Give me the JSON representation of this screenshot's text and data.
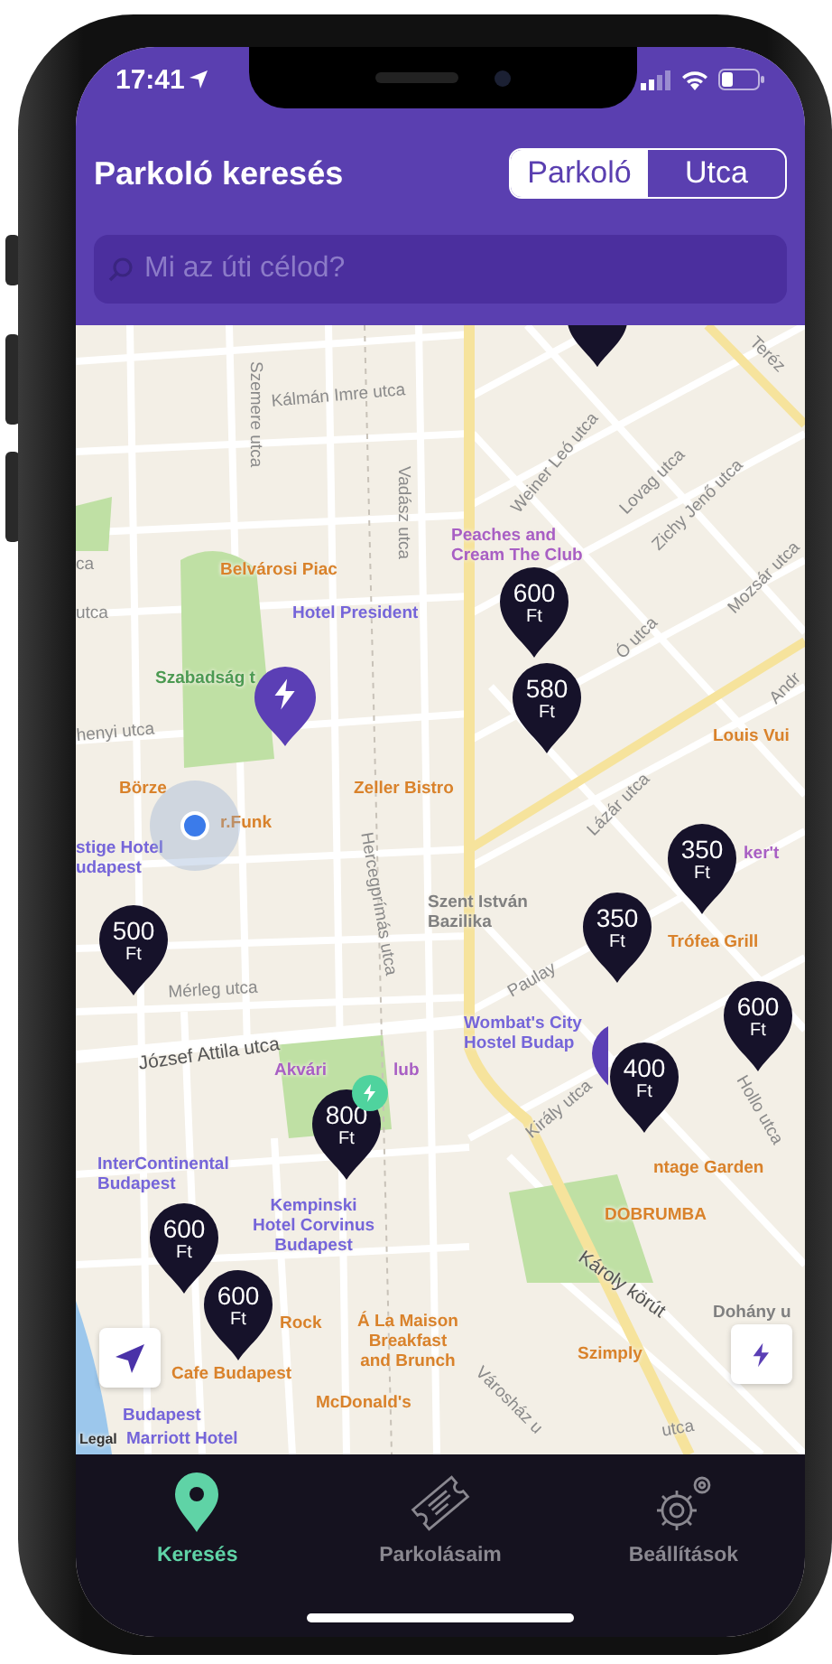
{
  "status_bar": {
    "time": "17:41"
  },
  "header": {
    "title": "Parkoló keresés",
    "segments": [
      {
        "label": "Parkoló",
        "selected": true
      },
      {
        "label": "Utca",
        "selected": false
      }
    ],
    "search": {
      "placeholder": "Mi az úti célod?"
    }
  },
  "map": {
    "labels": [
      {
        "text": "Kálmán Imre utca",
        "kind": "street"
      },
      {
        "text": "Szemere utca",
        "kind": "street"
      },
      {
        "text": "Vadász utca",
        "kind": "street"
      },
      {
        "text": "Weiner Leó utca",
        "kind": "street"
      },
      {
        "text": "Lovag utca",
        "kind": "street"
      },
      {
        "text": "Zichy Jenő utca",
        "kind": "street"
      },
      {
        "text": "Mozsár utca",
        "kind": "street"
      },
      {
        "text": "Teréz",
        "kind": "street"
      },
      {
        "text": "ca",
        "kind": "street"
      },
      {
        "text": "utca",
        "kind": "street"
      },
      {
        "text": "Peaches and\nCream The Club",
        "kind": "nightlife"
      },
      {
        "text": "Belvárosi Piac",
        "kind": "food"
      },
      {
        "text": "Hotel President",
        "kind": "hotel"
      },
      {
        "text": "Szabadság t",
        "kind": "park"
      },
      {
        "text": "Ó utca",
        "kind": "street"
      },
      {
        "text": "Andr",
        "kind": "street"
      },
      {
        "text": "Louis Vui",
        "kind": "food"
      },
      {
        "text": "Lázár utca",
        "kind": "street"
      },
      {
        "text": "henyi utca",
        "kind": "street"
      },
      {
        "text": "Börze",
        "kind": "food"
      },
      {
        "text": "Zeller Bistro",
        "kind": "food"
      },
      {
        "text": "r.Funk",
        "kind": "food"
      },
      {
        "text": "stige Hotel\nudapest",
        "kind": "hotel"
      },
      {
        "text": "Hercegprímás utca",
        "kind": "street"
      },
      {
        "text": "Szent István\nBazilika",
        "kind": "landmark"
      },
      {
        "text": "ker't",
        "kind": "nightlife"
      },
      {
        "text": "Trófea Grill",
        "kind": "food"
      },
      {
        "text": "Paulay",
        "kind": "street"
      },
      {
        "text": "Mérleg utca",
        "kind": "street"
      },
      {
        "text": "József Attila utca",
        "kind": "major"
      },
      {
        "text": "Wombat's City\nHostel Budap",
        "kind": "hotel"
      },
      {
        "text": "Hollo utca",
        "kind": "street"
      },
      {
        "text": "Akvári",
        "kind": "nightlife"
      },
      {
        "text": "lub",
        "kind": "nightlife"
      },
      {
        "text": "Király utca",
        "kind": "street"
      },
      {
        "text": "InterContinental\nBudapest",
        "kind": "hotel"
      },
      {
        "text": "ntage Garden",
        "kind": "food"
      },
      {
        "text": "Kempinski\nHotel Corvinus\nBudapest",
        "kind": "hotel"
      },
      {
        "text": "DOBRUMBA",
        "kind": "food"
      },
      {
        "text": "Károly körút",
        "kind": "major"
      },
      {
        "text": "Dohány u",
        "kind": "landmark"
      },
      {
        "text": "Rock",
        "kind": "food"
      },
      {
        "text": "Cafe Budapest",
        "kind": "food"
      },
      {
        "text": "Á La Maison\nBreakfast\nand Brunch",
        "kind": "food"
      },
      {
        "text": "Szimply",
        "kind": "food"
      },
      {
        "text": "Városház u",
        "kind": "street"
      },
      {
        "text": "Budapest",
        "kind": "hotel"
      },
      {
        "text": "Marriott Hotel",
        "kind": "hotel"
      },
      {
        "text": "McDonald's",
        "kind": "food"
      },
      {
        "text": "Legal",
        "kind": "legal"
      },
      {
        "text": "utca",
        "kind": "street"
      }
    ],
    "pins": [
      {
        "kind": "partial"
      },
      {
        "kind": "charger"
      },
      {
        "kind": "price",
        "price": "600",
        "unit": "Ft"
      },
      {
        "kind": "price",
        "price": "580",
        "unit": "Ft"
      },
      {
        "kind": "price",
        "price": "350",
        "unit": "Ft"
      },
      {
        "kind": "price",
        "price": "350",
        "unit": "Ft"
      },
      {
        "kind": "price",
        "price": "500",
        "unit": "Ft"
      },
      {
        "kind": "price",
        "price": "600",
        "unit": "Ft"
      },
      {
        "kind": "charger"
      },
      {
        "kind": "price",
        "price": "400",
        "unit": "Ft"
      },
      {
        "kind": "price",
        "price": "800",
        "unit": "Ft"
      },
      {
        "kind": "charger-small"
      },
      {
        "kind": "price",
        "price": "600",
        "unit": "Ft"
      },
      {
        "kind": "price",
        "price": "600",
        "unit": "Ft"
      }
    ]
  },
  "tabs": [
    {
      "label": "Keresés",
      "selected": true
    },
    {
      "label": "Parkolásaim",
      "selected": false
    },
    {
      "label": "Beállítások",
      "selected": false
    }
  ]
}
